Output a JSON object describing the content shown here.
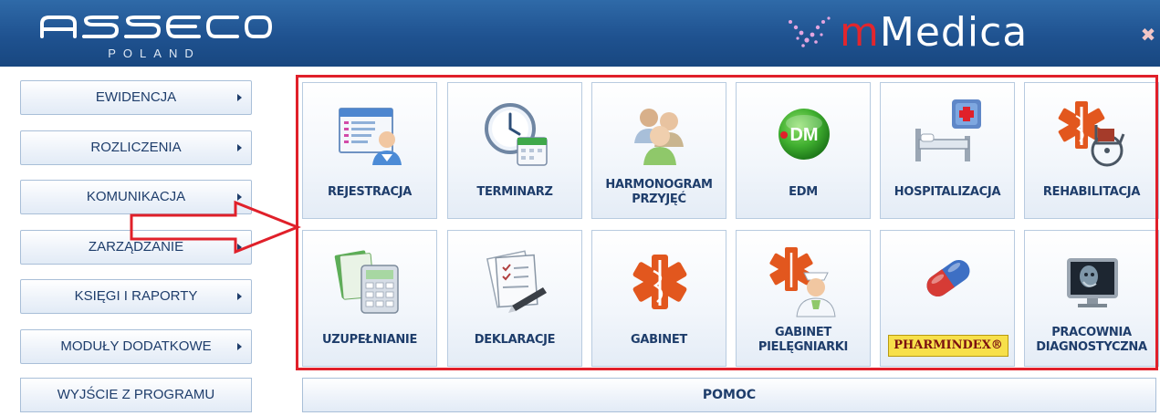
{
  "header": {
    "logo_text": "asseco",
    "logo_sub": "POLAND",
    "brand_prefix": "m",
    "brand_name": "Medica",
    "close_symbol": "✖"
  },
  "menu": {
    "items": [
      {
        "label": "EWIDENCJA",
        "has_submenu": true
      },
      {
        "label": "ROZLICZENIA",
        "has_submenu": true
      },
      {
        "label": "KOMUNIKACJA",
        "has_submenu": true
      },
      {
        "label": "ZARZĄDZANIE",
        "has_submenu": true
      },
      {
        "label": "KSIĘGI I RAPORTY",
        "has_submenu": true
      },
      {
        "label": "MODUŁY DODATKOWE",
        "has_submenu": true
      }
    ],
    "exit_label": "WYJŚCIE Z PROGRAMU"
  },
  "tiles": [
    {
      "label": "REJESTRACJA",
      "icon": "registration-icon"
    },
    {
      "label": "TERMINARZ",
      "icon": "clock-calendar-icon"
    },
    {
      "label": "HARMONOGRAM PRZYJĘĆ",
      "icon": "people-group-icon"
    },
    {
      "label": "EDM",
      "icon": "edm-icon",
      "badge": "DM"
    },
    {
      "label": "HOSPITALIZACJA",
      "icon": "hospital-bed-icon"
    },
    {
      "label": "REHABILITACJA",
      "icon": "wheelchair-icon"
    },
    {
      "label": "UZUPEŁNIANIE",
      "icon": "calculator-icon"
    },
    {
      "label": "DEKLARACJE",
      "icon": "document-pen-icon"
    },
    {
      "label": "GABINET",
      "icon": "star-of-life-icon"
    },
    {
      "label": "GABINET PIELĘGNIARKI",
      "icon": "nurse-icon"
    },
    {
      "label": "PHARMINDEX®",
      "icon": "pill-icon"
    },
    {
      "label": "PRACOWNIA DIAGNOSTYCZNA",
      "icon": "xray-monitor-icon"
    }
  ],
  "help_label": "POMOC",
  "colors": {
    "header": "#1f5290",
    "accent_red": "#e0202a",
    "label_text": "#1e3d6b",
    "pharmindex_bg": "#f7e04a"
  }
}
